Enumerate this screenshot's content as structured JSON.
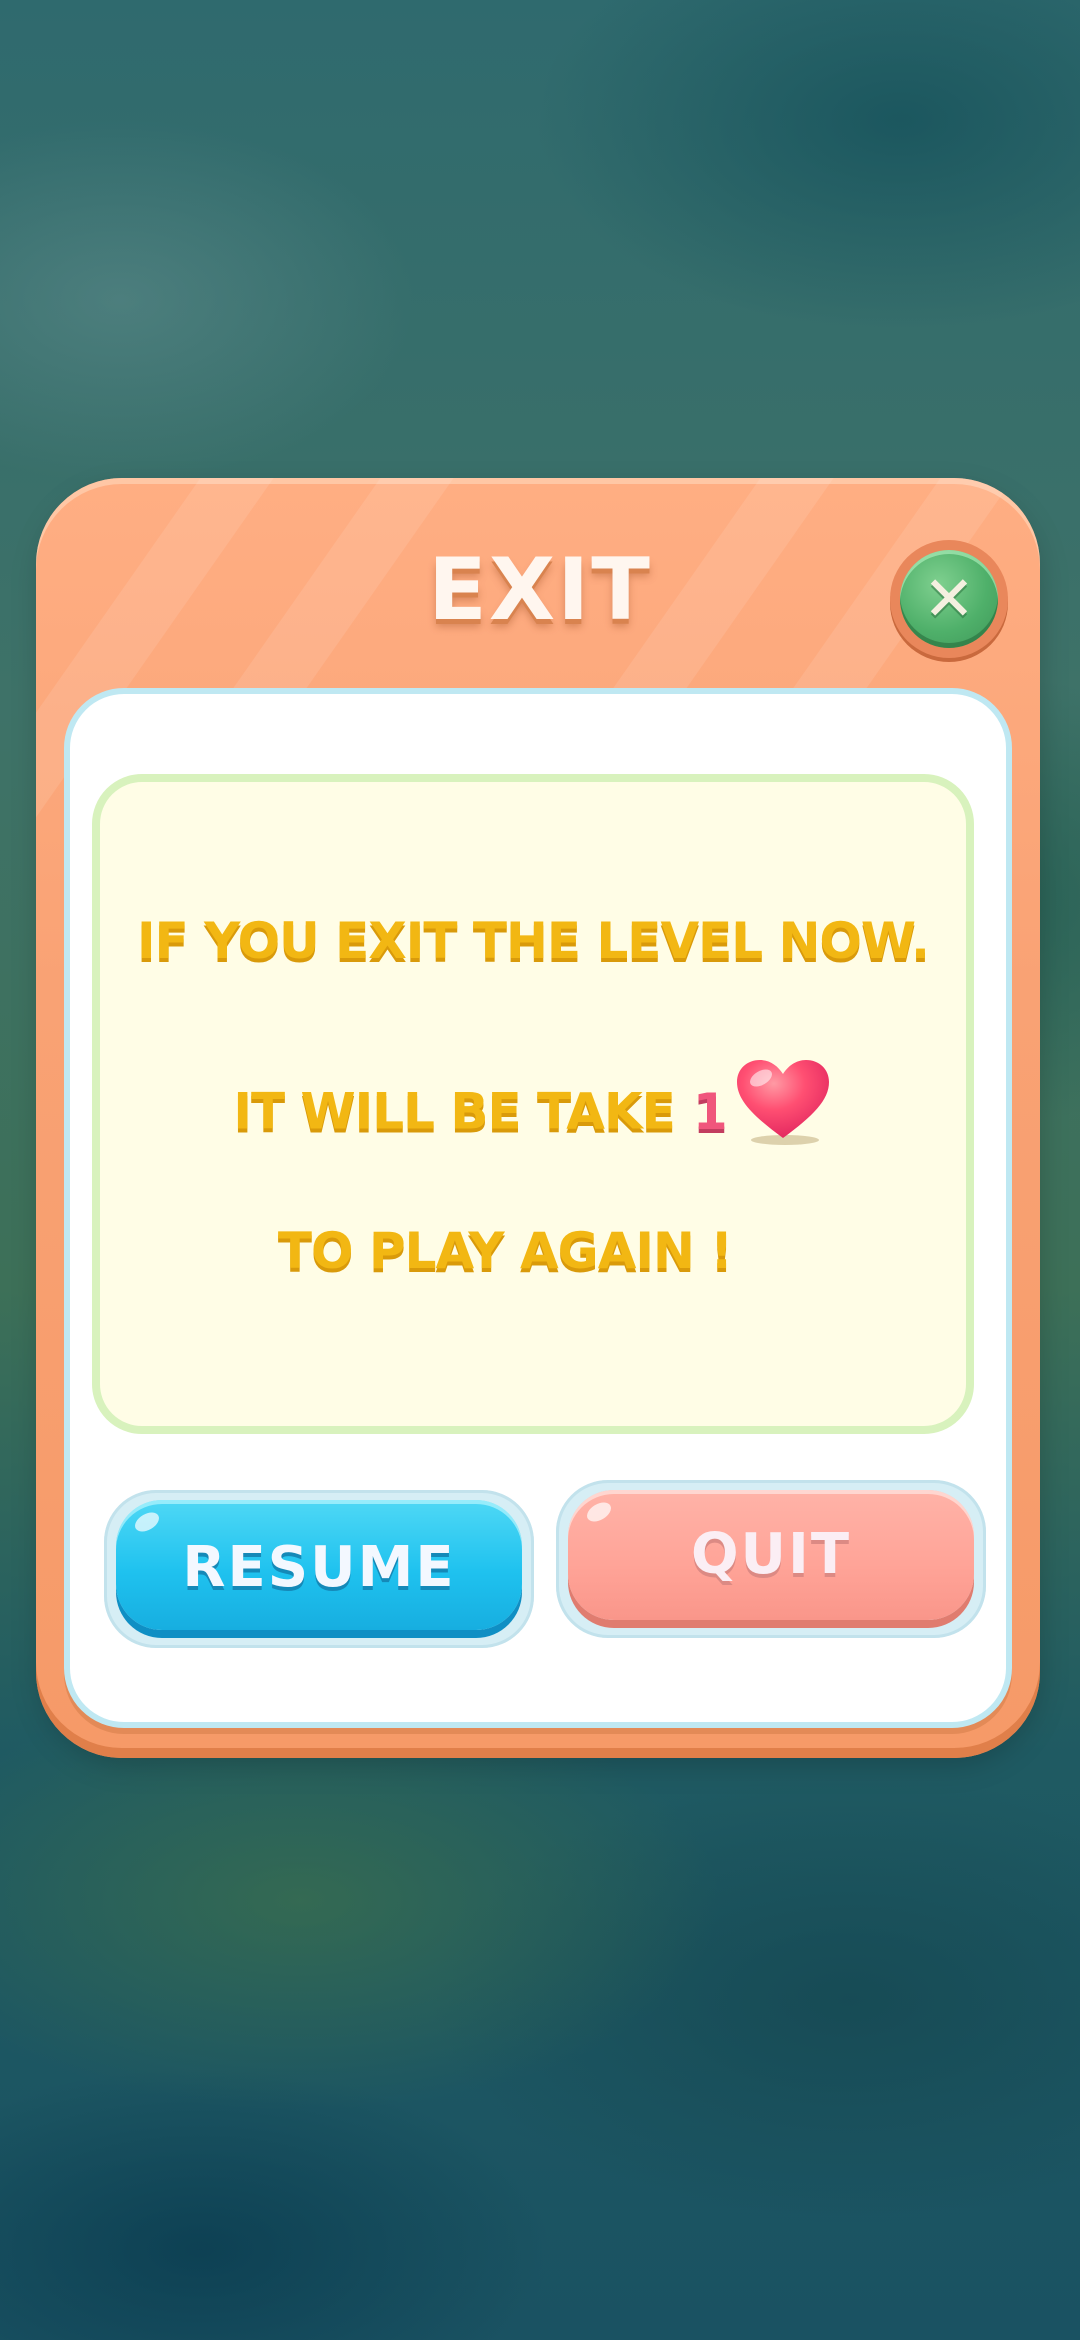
{
  "dialog": {
    "title": "EXIT",
    "close_icon": "close-x-icon",
    "message": {
      "line1": "IF YOU EXIT THE LEVEL NOW.",
      "line2_text": "IT WILL BE TAKE",
      "line2_count": "1",
      "line2_icon": "heart-icon",
      "line3": "TO PLAY AGAIN !"
    },
    "buttons": {
      "resume_label": "RESUME",
      "quit_label": "QUIT"
    }
  },
  "colors": {
    "panel": "#f9a274",
    "message_text": "#f2b713",
    "heart": "#f0567c",
    "resume": "#1fc2ef",
    "quit": "#ffa397",
    "close": "#4fb06a"
  }
}
